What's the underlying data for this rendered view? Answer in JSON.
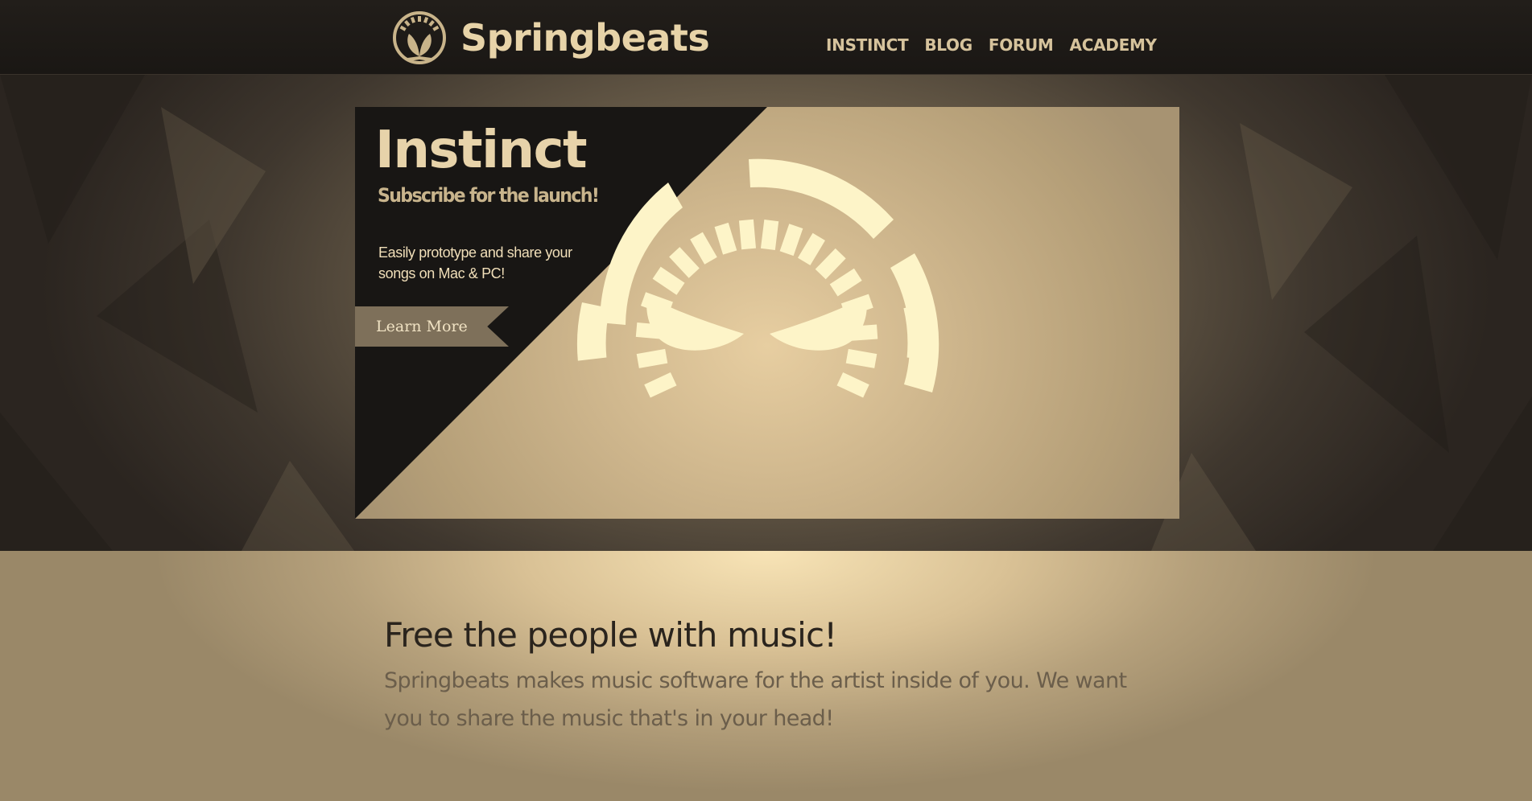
{
  "header": {
    "brand_name": "Springbeats",
    "logo_icon": "springbeats-logo-icon",
    "nav": [
      {
        "label": "INSTINCT"
      },
      {
        "label": "BLOG"
      },
      {
        "label": "FORUM"
      },
      {
        "label": "ACADEMY"
      }
    ]
  },
  "hero": {
    "title": "Instinct",
    "subtitle": "Subscribe for the launch!",
    "description": "Easily prototype and share your songs on Mac & PC!",
    "cta_label": "Learn More",
    "art_icon": "instinct-mask-dial-icon"
  },
  "intro": {
    "heading": "Free the people with music!",
    "body": "Springbeats makes music software for the artist inside of you. We want you to share the music that's in your head!"
  },
  "colors": {
    "header_bg": "#1c1916",
    "brand_text": "#e7d3a8",
    "nav_text": "#d6c39c",
    "banner_dark": "#181614",
    "banner_art": "#fdf4c8",
    "cta_bg": "#7e705a",
    "intro_heading": "#2a241d",
    "intro_body": "#6b5e4b"
  }
}
